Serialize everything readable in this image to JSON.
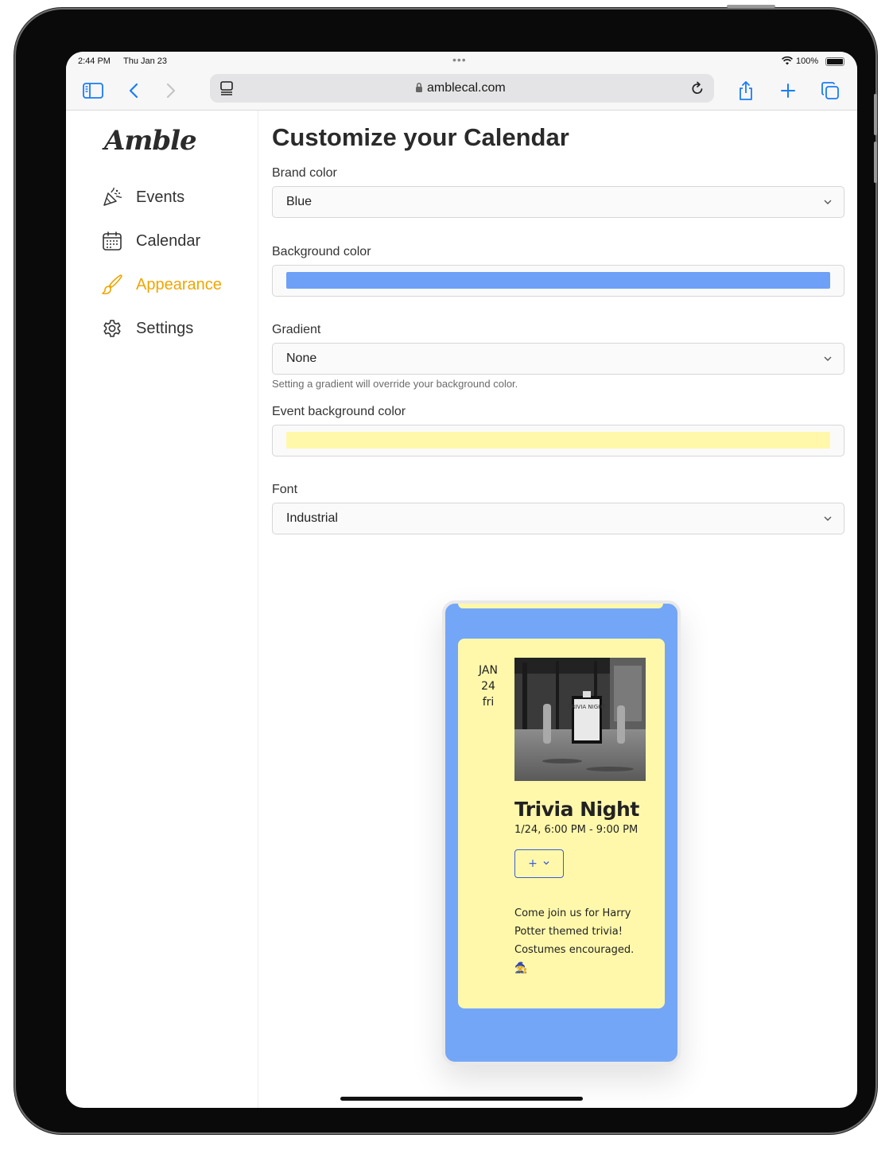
{
  "status_bar": {
    "time": "2:44 PM",
    "date": "Thu Jan 23",
    "battery_text": "100%"
  },
  "browser": {
    "url": "amblecal.com"
  },
  "sidebar": {
    "logo": "Amble",
    "items": [
      {
        "label": "Events",
        "icon": "party-popper-icon",
        "active": false
      },
      {
        "label": "Calendar",
        "icon": "calendar-icon",
        "active": false
      },
      {
        "label": "Appearance",
        "icon": "paintbrush-icon",
        "active": true
      },
      {
        "label": "Settings",
        "icon": "gear-icon",
        "active": false
      }
    ]
  },
  "main": {
    "title": "Customize your Calendar",
    "brand_color": {
      "label": "Brand color",
      "value": "Blue"
    },
    "background_color": {
      "label": "Background color",
      "value": "#6ea0f7"
    },
    "gradient": {
      "label": "Gradient",
      "value": "None",
      "hint": "Setting a gradient will override your background color."
    },
    "event_background_color": {
      "label": "Event background color",
      "value": "#fff8ab"
    },
    "font": {
      "label": "Font",
      "value": "Industrial"
    }
  },
  "preview": {
    "background": "#74a6f7",
    "event_background": "#fff8ab",
    "event": {
      "month": "JAN",
      "day": "24",
      "weekday": "fri",
      "title": "Trivia Night",
      "time": "1/24, 6:00 PM - 9:00 PM",
      "add_button": "+",
      "description": "Come join us for Harry Potter themed trivia! Costumes encouraged. 🧙",
      "photo_sign_text": "TRIVIA NIGHT"
    }
  },
  "colors": {
    "accent": "#f0a500",
    "button_outline": "#3b5bdb",
    "ios_blue": "#1a7cf5"
  }
}
